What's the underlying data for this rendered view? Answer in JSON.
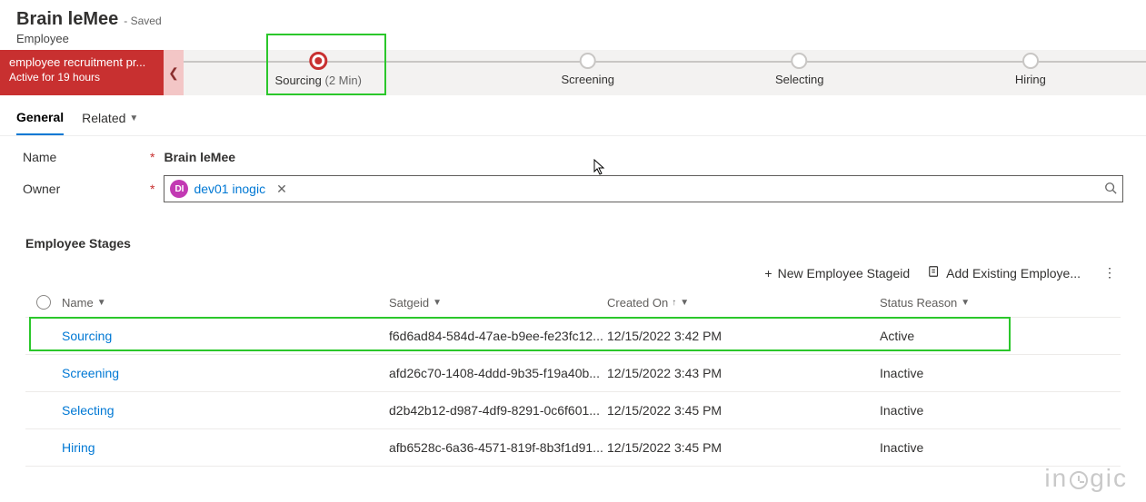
{
  "header": {
    "title": "Brain leMee",
    "saved_label": "- Saved",
    "entity": "Employee"
  },
  "process": {
    "name": "employee recruitment pr...",
    "duration": "Active for 19 hours",
    "stages": [
      {
        "label": "Sourcing",
        "duration": "(2 Min)",
        "current": true
      },
      {
        "label": "Screening",
        "duration": "",
        "current": false
      },
      {
        "label": "Selecting",
        "duration": "",
        "current": false
      },
      {
        "label": "Hiring",
        "duration": "",
        "current": false
      }
    ]
  },
  "tabs": {
    "general": "General",
    "related": "Related"
  },
  "form": {
    "name_label": "Name",
    "name_value": "Brain leMee",
    "owner_label": "Owner",
    "owner_badge": "DI",
    "owner_value": "dev01 inogic"
  },
  "subgrid": {
    "title": "Employee Stages",
    "commands": {
      "new": "New Employee Stageid",
      "add_existing": "Add Existing Employe..."
    },
    "columns": {
      "name": "Name",
      "satgeid": "Satgeid",
      "created_on": "Created On",
      "status": "Status Reason"
    },
    "rows": [
      {
        "name": "Sourcing",
        "satgeid": "f6d6ad84-584d-47ae-b9ee-fe23fc12...",
        "created_on": "12/15/2022 3:42 PM",
        "status": "Active"
      },
      {
        "name": "Screening",
        "satgeid": "afd26c70-1408-4ddd-9b35-f19a40b...",
        "created_on": "12/15/2022 3:43 PM",
        "status": "Inactive"
      },
      {
        "name": "Selecting",
        "satgeid": "d2b42b12-d987-4df9-8291-0c6f601...",
        "created_on": "12/15/2022 3:45 PM",
        "status": "Inactive"
      },
      {
        "name": "Hiring",
        "satgeid": "afb6528c-6a36-4571-819f-8b3f1d91...",
        "created_on": "12/15/2022 3:45 PM",
        "status": "Inactive"
      }
    ]
  },
  "watermark": "inogic"
}
